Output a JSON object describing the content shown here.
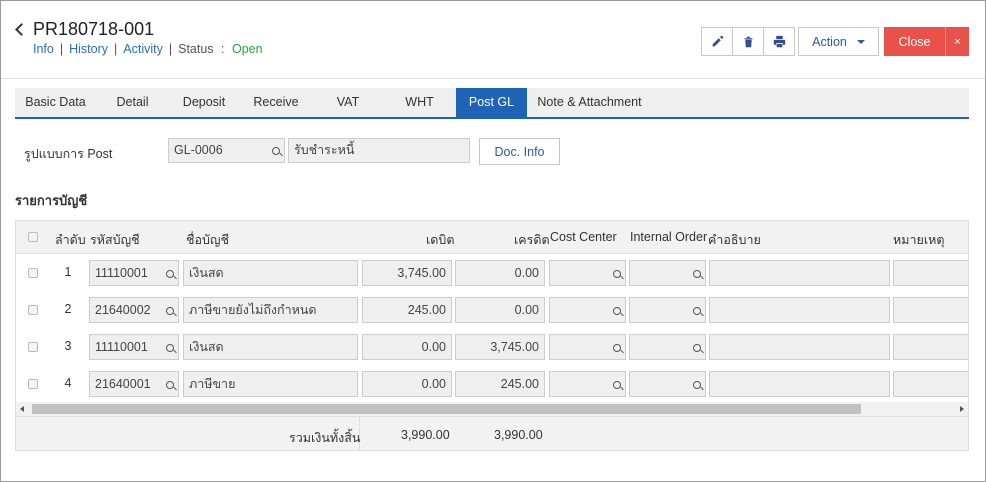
{
  "header": {
    "title": "PR180718-001",
    "links": {
      "info": "Info",
      "history": "History",
      "activity": "Activity"
    },
    "separator": "|",
    "status_label": "Status",
    "status_colon": ":",
    "status_value": "Open",
    "action_label": "Action",
    "close_label": "Close",
    "close_x": "×",
    "icons": [
      "pencil-icon",
      "trash-icon",
      "printer-icon"
    ]
  },
  "tabs": [
    "Basic Data",
    "Detail",
    "Deposit",
    "Receive",
    "VAT",
    "WHT",
    "Post GL",
    "Note & Attachment"
  ],
  "active_tab": "Post GL",
  "post_form": {
    "label": "รูปแบบการ Post",
    "code": "GL-0006",
    "name": "รับชำระหนี้",
    "doc_info_label": "Doc. Info"
  },
  "section_title": "รายการบัญชี",
  "grid": {
    "columns": {
      "no": "ลำดับ",
      "account_code": "รหัสบัญชี",
      "account_name": "ชื่อบัญชี",
      "debit": "เดบิต",
      "credit": "เครดิต",
      "cost_center": "Cost Center",
      "internal_order": "Internal Order",
      "description": "คำอธิบาย",
      "remark": "หมายเหตุ"
    },
    "rows": [
      {
        "no": "1",
        "account_code": "11110001",
        "account_name": "เงินสด",
        "debit": "3,745.00",
        "credit": "0.00"
      },
      {
        "no": "2",
        "account_code": "21640002",
        "account_name": "ภาษีขายยังไม่ถึงกำหนด",
        "debit": "245.00",
        "credit": "0.00"
      },
      {
        "no": "3",
        "account_code": "11110001",
        "account_name": "เงินสด",
        "debit": "0.00",
        "credit": "3,745.00"
      },
      {
        "no": "4",
        "account_code": "21640001",
        "account_name": "ภาษีขาย",
        "debit": "0.00",
        "credit": "245.00"
      }
    ],
    "footer": {
      "label": "รวมเงินทั้งสิ้น",
      "debit_total": "3,990.00",
      "credit_total": "3,990.00"
    }
  }
}
